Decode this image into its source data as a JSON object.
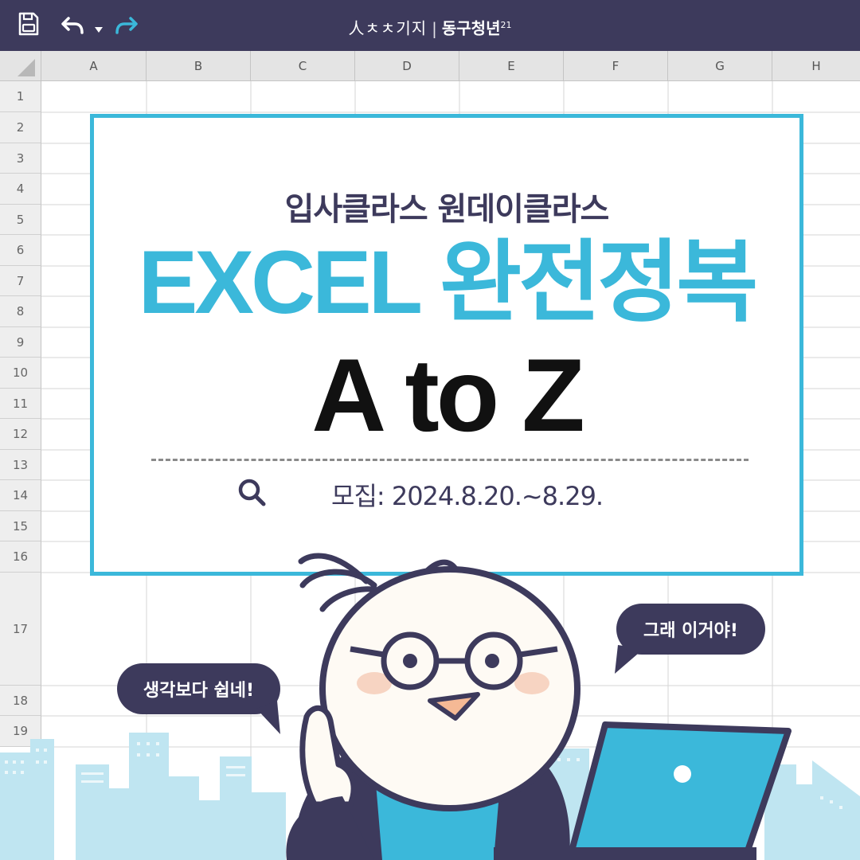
{
  "toolbar": {
    "brand_logo": "人ㅊㅊ기지",
    "brand_separator": "|",
    "brand_org": "동구청년",
    "brand_org_sup": "21"
  },
  "sheet": {
    "columns": [
      "A",
      "B",
      "C",
      "D",
      "E",
      "F",
      "G",
      "H"
    ],
    "rows": [
      "1",
      "2",
      "3",
      "4",
      "5",
      "6",
      "7",
      "8",
      "9",
      "10",
      "11",
      "12",
      "13",
      "14",
      "15",
      "16",
      "17",
      "18",
      "19"
    ]
  },
  "card": {
    "subtitle": "입사클라스 원데이클라스",
    "headline": "EXCEL 완전정복",
    "big": "A to Z",
    "recruit": "모집: 2024.8.20.~8.29."
  },
  "bubbles": {
    "left": "생각보다 쉽네!",
    "right": "그래 이거야!"
  },
  "colors": {
    "toolbar": "#3d3a5c",
    "accent": "#3bb8da",
    "navy": "#3d3a5c",
    "city": "#bfe5f1"
  }
}
